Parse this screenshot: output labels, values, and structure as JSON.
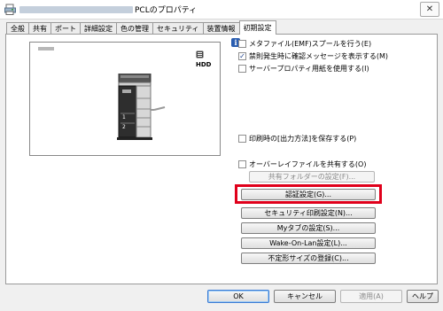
{
  "window": {
    "title_suffix": "PCLのプロパティ",
    "close_label": "✕"
  },
  "tabs": [
    {
      "label": "全般"
    },
    {
      "label": "共有"
    },
    {
      "label": "ポート"
    },
    {
      "label": "詳細設定"
    },
    {
      "label": "色の管理"
    },
    {
      "label": "セキュリティ"
    },
    {
      "label": "装置情報"
    },
    {
      "label": "初期設定"
    }
  ],
  "active_tab_index": 7,
  "preview": {
    "hdd_label": "HDD",
    "tray_labels": [
      "1",
      "2"
    ]
  },
  "info_icon": "i",
  "checkboxes": [
    {
      "label": "メタファイル(EMF)スプールを行う(E)",
      "checked": false
    },
    {
      "label": "禁則発生時に確認メッセージを表示する(M)",
      "checked": true
    },
    {
      "label": "サーバープロパティ用紙を使用する(I)",
      "checked": false
    },
    {
      "label": "印刷時の[出力方法]を保存する(P)",
      "checked": false
    },
    {
      "label": "オーバーレイファイルを共有する(O)",
      "checked": false
    }
  ],
  "buttons": {
    "shared_folder": "共有フォルダーの設定(F)...",
    "auth": "認証設定(G)...",
    "security_print": "セキュリティ印刷設定(N)...",
    "mytab": "Myタブの設定(S)...",
    "wake_on_lan": "Wake-On-Lan設定(L)...",
    "custom_size": "不定形サイズの登録(C)..."
  },
  "footer": {
    "ok": "OK",
    "cancel": "キャンセル",
    "apply": "適用(A)",
    "help": "ヘルプ"
  },
  "colors": {
    "highlight": "#e0001b",
    "check_mark": "#1b3f8b"
  }
}
